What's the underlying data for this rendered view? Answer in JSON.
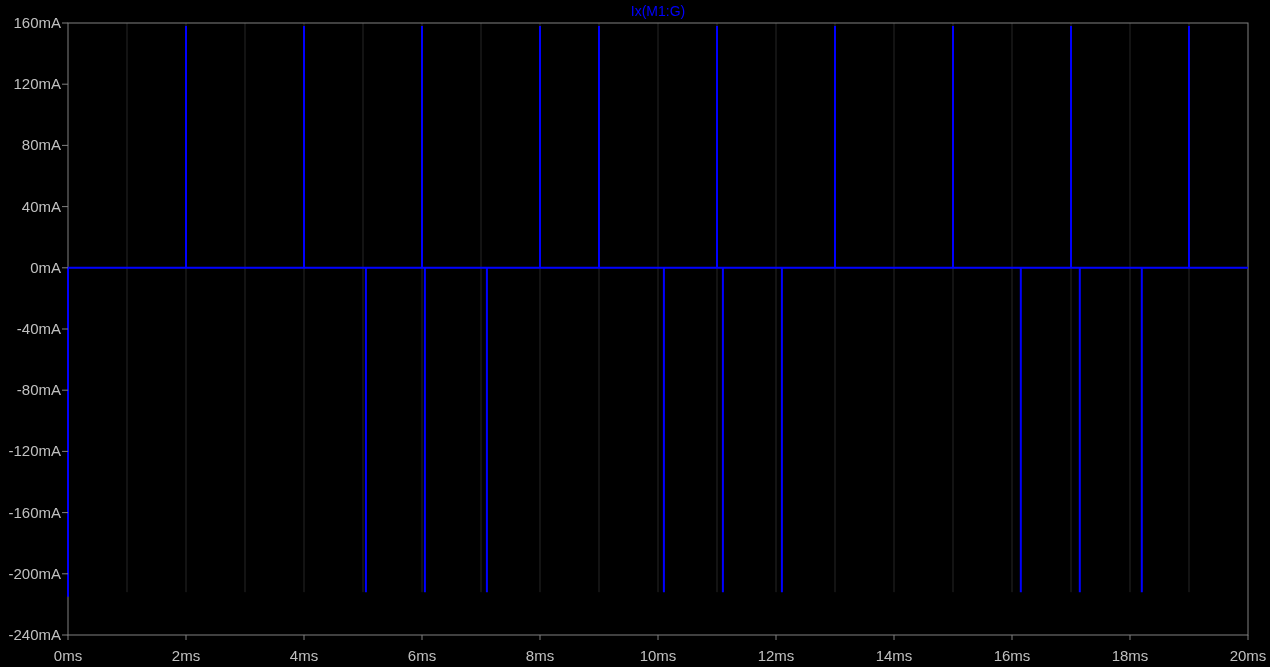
{
  "plot": {
    "chart_data": {
      "type": "line",
      "grid": true,
      "xlim": [
        0,
        20
      ],
      "ylim": [
        -240,
        160
      ],
      "xticks": [
        {
          "value": 0,
          "label": "0ms"
        },
        {
          "value": 2,
          "label": "2ms"
        },
        {
          "value": 4,
          "label": "4ms"
        },
        {
          "value": 6,
          "label": "6ms"
        },
        {
          "value": 8,
          "label": "8ms"
        },
        {
          "value": 10,
          "label": "10ms"
        },
        {
          "value": 12,
          "label": "12ms"
        },
        {
          "value": 14,
          "label": "14ms"
        },
        {
          "value": 16,
          "label": "16ms"
        },
        {
          "value": 18,
          "label": "18ms"
        },
        {
          "value": 20,
          "label": "20ms"
        }
      ],
      "yticks": [
        {
          "value": 160,
          "label": "160mA"
        },
        {
          "value": 120,
          "label": "120mA"
        },
        {
          "value": 80,
          "label": "80mA"
        },
        {
          "value": 40,
          "label": "40mA"
        },
        {
          "value": 0,
          "label": "0mA"
        },
        {
          "value": -40,
          "label": "-40mA"
        },
        {
          "value": -80,
          "label": "-80mA"
        },
        {
          "value": -120,
          "label": "-120mA"
        },
        {
          "value": -160,
          "label": "-160mA"
        },
        {
          "value": -200,
          "label": "-200mA"
        },
        {
          "value": -240,
          "label": "-240mA"
        }
      ],
      "x": [
        0,
        0,
        2,
        2,
        2,
        4,
        4,
        4,
        5.05,
        5.05,
        5.05,
        6,
        6,
        6,
        6.05,
        6.05,
        6.05,
        7.1,
        7.1,
        7.1,
        8,
        8,
        8,
        9,
        9,
        9,
        10.1,
        10.1,
        10.1,
        11,
        11,
        11,
        11.1,
        11.1,
        11.1,
        12.1,
        12.1,
        12.1,
        13,
        13,
        13,
        15,
        15,
        15,
        16.15,
        16.15,
        16.15,
        17,
        17,
        17,
        17.15,
        17.15,
        17.15,
        18.2,
        18.2,
        18.2,
        19,
        19,
        19,
        20
      ],
      "series": [
        {
          "name": "Ix(M1:G)",
          "color": "#0000ff",
          "values": [
            -215,
            0,
            0,
            158,
            0,
            0,
            158,
            0,
            0,
            -212,
            0,
            0,
            158,
            0,
            0,
            -212,
            0,
            0,
            -212,
            0,
            0,
            158,
            0,
            0,
            158,
            0,
            0,
            -212,
            0,
            0,
            158,
            0,
            0,
            -212,
            0,
            0,
            -212,
            0,
            0,
            158,
            0,
            0,
            158,
            0,
            0,
            -212,
            0,
            0,
            158,
            0,
            0,
            -212,
            0,
            0,
            -212,
            0,
            0,
            158,
            0,
            0
          ]
        }
      ]
    }
  }
}
